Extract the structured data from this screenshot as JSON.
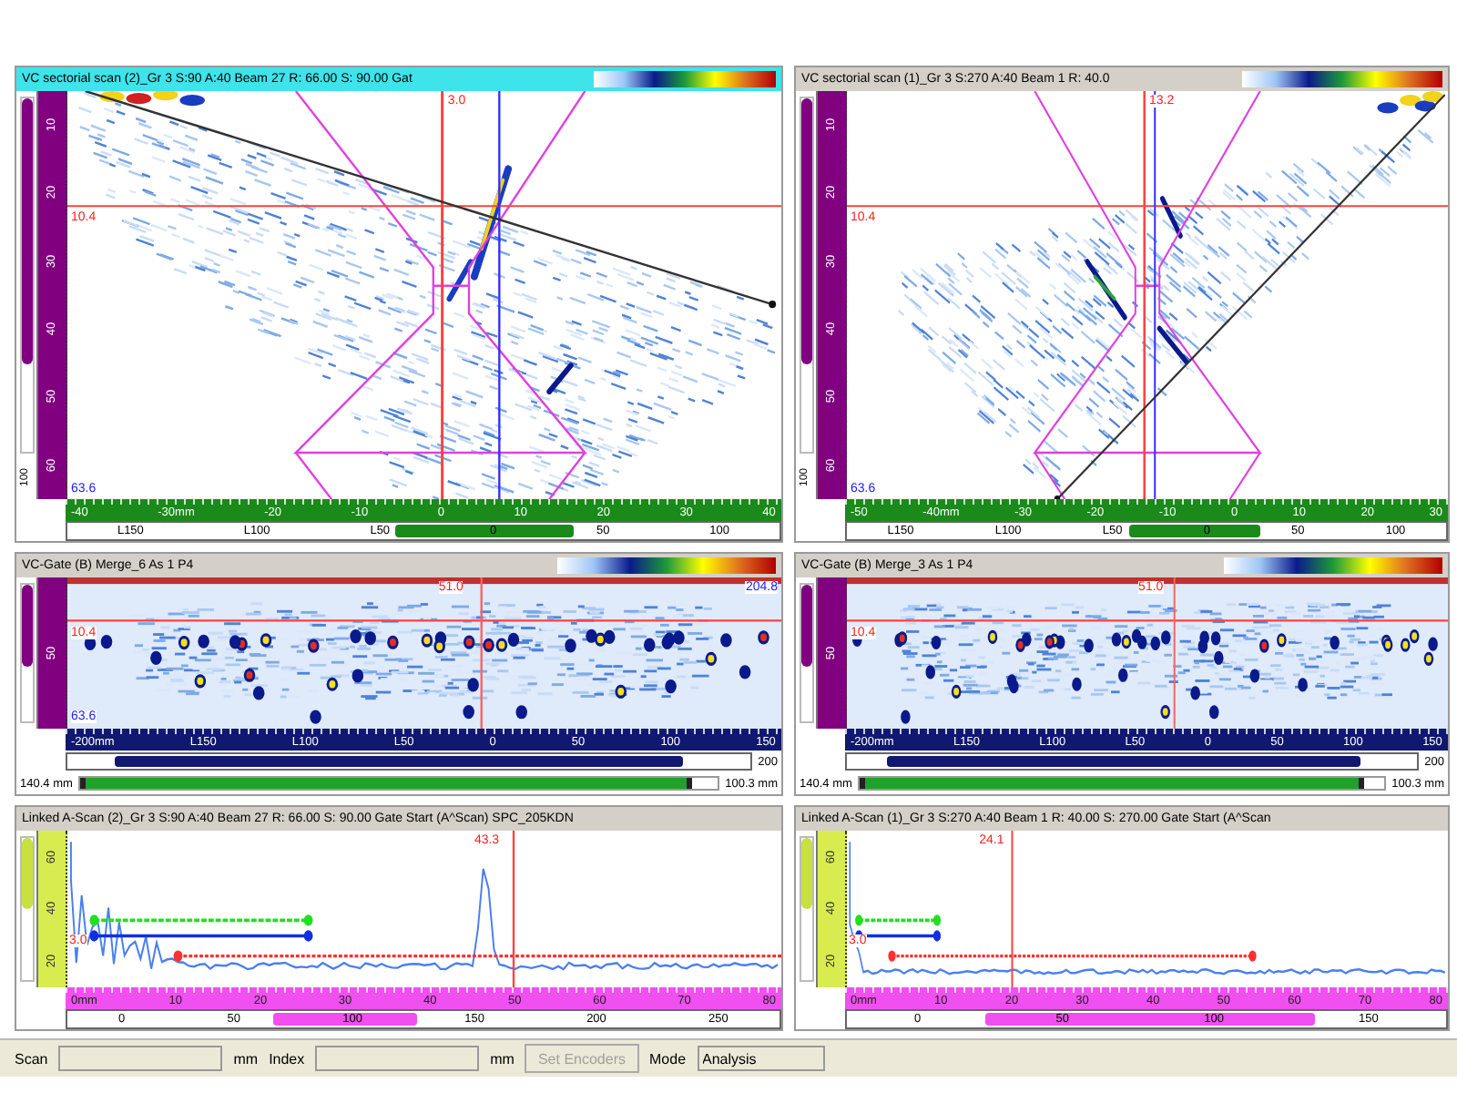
{
  "columns": [
    {
      "sectorial": {
        "title": "VC sectorial scan (2)_Gr 3 S:90 A:40 Beam 27 R: 66.00 S: 90.00 Gat",
        "active": true,
        "gain_slider": {
          "level": 0.75
        },
        "depth_ruler": [
          "10",
          "20",
          "30",
          "40",
          "50",
          "60"
        ],
        "slider_label": "100",
        "depth_cursor": "10.4",
        "scan_cursor": "3.0",
        "bottom_label": "63.6",
        "x_ruler": [
          "-40",
          "-30mm",
          "-20",
          "-10",
          "0",
          "10",
          "20",
          "30",
          "40"
        ],
        "index_ruler": [
          "L150",
          "L100",
          "L50",
          "0",
          "50",
          "100"
        ]
      },
      "cscan": {
        "title": "VC-Gate (B) Merge_6 As 1 P4",
        "active": false,
        "gain_slider": {
          "level": 0.6
        },
        "range_slider": {
          "level": 0.96
        },
        "depth_ruler": [
          "50"
        ],
        "scan_cursor": "51.0",
        "depth_cursor": "10.4",
        "right_label": "204.8",
        "bottom_label": "63.6",
        "x_ruler": [
          "-200mm",
          "L150",
          "L100",
          "L50",
          "0",
          "50",
          "100",
          "150"
        ],
        "track_label": "200",
        "range_start": "140.4 mm",
        "range_end": "100.3 mm"
      },
      "ascan": {
        "title": "Linked A-Scan (2)_Gr 3 S:90 A:40 Beam 27 R: 66.00 S: 90.00 Gate Start (A^Scan) SPC_205KDN",
        "active": false,
        "gain_slider": {
          "level": 0.5
        },
        "amplitude_ruler": [
          "60",
          "40",
          "20"
        ],
        "cursor": "43.3",
        "gate_label": "3.0",
        "x_ruler": [
          "0mm",
          "10",
          "20",
          "30",
          "40",
          "50",
          "60",
          "70",
          "80"
        ],
        "index_ruler": [
          "0",
          "50",
          "100",
          "150",
          "200",
          "250"
        ]
      }
    },
    {
      "sectorial": {
        "title": "VC sectorial scan (1)_Gr 3 S:270 A:40 Beam 1 R: 40.0",
        "active": false,
        "gain_slider": {
          "level": 0.75
        },
        "depth_ruler": [
          "10",
          "20",
          "30",
          "40",
          "50",
          "60"
        ],
        "slider_label": "100",
        "depth_cursor": "10.4",
        "scan_cursor": "13.2",
        "bottom_label": "63.6",
        "x_ruler": [
          "-50",
          "-40mm",
          "-30",
          "-20",
          "-10",
          "0",
          "10",
          "20",
          "30"
        ],
        "index_ruler": [
          "L150",
          "L100",
          "L50",
          "0",
          "50",
          "100"
        ]
      },
      "cscan": {
        "title": "VC-Gate (B) Merge_3 As 1 P4",
        "active": false,
        "gain_slider": {
          "level": 0.6
        },
        "range_slider": {
          "level": 0.96
        },
        "depth_ruler": [
          "50"
        ],
        "scan_cursor": "51.0",
        "depth_cursor": "10.4",
        "x_ruler": [
          "-200mm",
          "L150",
          "L100",
          "L50",
          "0",
          "50",
          "100",
          "150"
        ],
        "track_label": "200",
        "range_start": "140.4 mm",
        "range_end": "100.3 mm"
      },
      "ascan": {
        "title": "Linked A-Scan (1)_Gr 3 S:270 A:40 Beam 1 R: 40.00 S: 270.00 Gate Start (A^Scan",
        "active": false,
        "gain_slider": {
          "level": 0.5
        },
        "amplitude_ruler": [
          "60",
          "40",
          "20"
        ],
        "cursor": "24.1",
        "gate_label": "3.0",
        "x_ruler": [
          "0mm",
          "10",
          "20",
          "30",
          "40",
          "50",
          "60",
          "70",
          "80"
        ],
        "index_ruler": [
          "0",
          "50",
          "100",
          "150"
        ]
      }
    }
  ],
  "status_bar": {
    "scan_label": "Scan",
    "scan_unit": "mm",
    "index_label": "Index",
    "index_unit": "mm",
    "set_encoders": {
      "label": "Set Encoders",
      "disabled": true
    },
    "mode_label": "Mode",
    "mode_value": "Analysis"
  }
}
